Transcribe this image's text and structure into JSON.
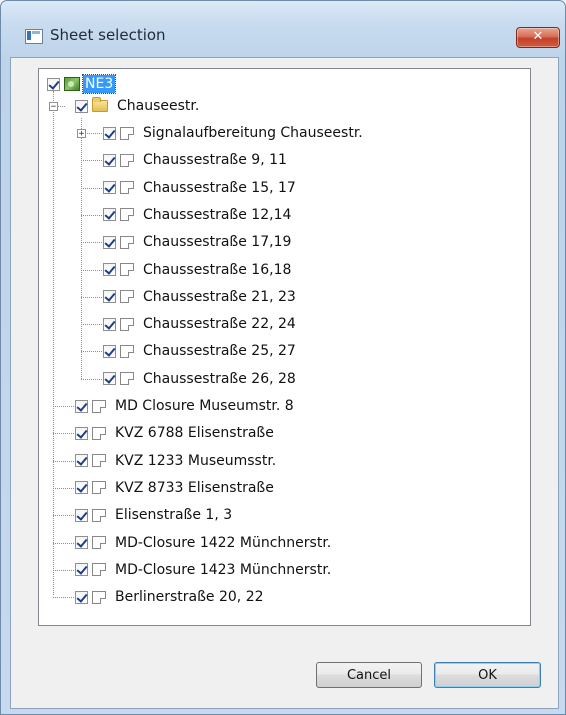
{
  "window": {
    "title": "Sheet selection",
    "close_label": "✕"
  },
  "tree": {
    "root": {
      "label": "NE3"
    },
    "folder": {
      "label": "Chauseestr."
    },
    "folder_children": [
      "Signalaufbereitung Chauseestr.",
      "Chaussestraße  9, 11",
      "Chaussestraße  15, 17",
      "Chaussestraße  12,14",
      "Chaussestraße  17,19",
      "Chaussestraße  16,18",
      "Chaussestraße  21, 23",
      "Chaussestraße  22, 24",
      "Chaussestraße  25, 27",
      "Chaussestraße  26, 28"
    ],
    "root_children": [
      "MD Closure Museumstr. 8",
      "KVZ 6788 Elisenstraße",
      "KVZ 1233 Museumsstr.",
      "KVZ 8733 Elisenstraße",
      "Elisenstraße 1, 3",
      "MD-Closure 1422 Münchnerstr.",
      "MD-Closure 1423 Münchnerstr.",
      "Berlinerstraße 20, 22"
    ],
    "expand_symbols": {
      "expanded": "−",
      "collapsed": "+"
    }
  },
  "buttons": {
    "cancel": "Cancel",
    "ok": "OK"
  }
}
